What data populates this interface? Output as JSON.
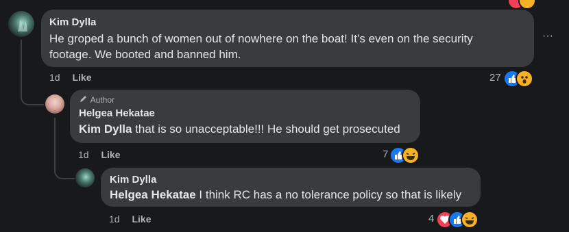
{
  "comments": [
    {
      "author": "Kim Dylla",
      "text": "He groped a bunch of women out of nowhere on the boat! It’s even on the security footage. We booted and banned him.",
      "time": "1d",
      "like_label": "Like",
      "reaction_count": "27",
      "reactions": [
        "like-reaction",
        "wow-reaction"
      ]
    },
    {
      "badge": "Author",
      "author": "Helgea Hekatae",
      "mention": "Kim Dylla",
      "text": " that is so unacceptable!!! He should get prosecuted",
      "time": "1d",
      "like_label": "Like",
      "reaction_count": "7",
      "reactions": [
        "like-reaction",
        "haha-reaction"
      ]
    },
    {
      "author": "Kim Dylla",
      "mention": "Helgea Hekatae",
      "text": " I think RC has a no tolerance policy so that is likely",
      "time": "1d",
      "like_label": "Like",
      "reaction_count": "4",
      "reactions": [
        "love-reaction",
        "like-reaction",
        "haha-reaction"
      ]
    }
  ],
  "more_button": "···",
  "colors": {
    "background": "#18191a",
    "bubble": "#3a3b3c",
    "text": "#e4e6eb",
    "muted": "#b0b3b8",
    "like": "#1877f2",
    "love": "#f33e58",
    "wow": "#f7b125"
  }
}
